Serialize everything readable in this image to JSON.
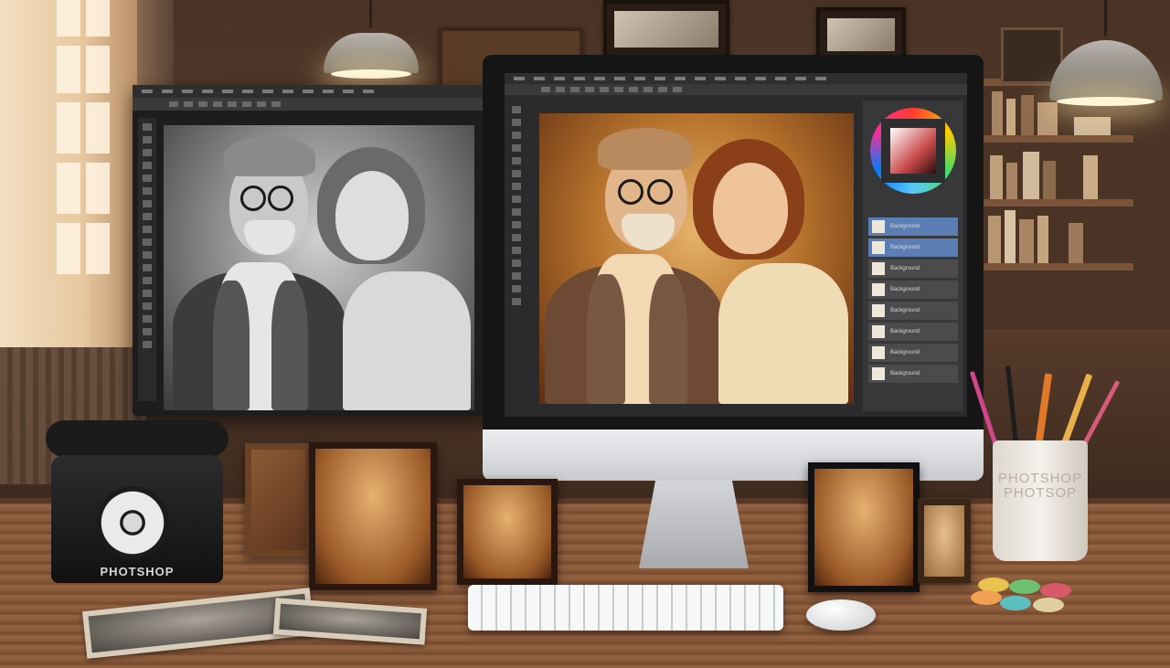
{
  "scene": {
    "description_visible_text": true
  },
  "left_monitor": {
    "app_menu_items": 12,
    "photo": "black-and-white portrait"
  },
  "imac_screen": {
    "panels": {
      "layers": [
        {
          "name": "Background",
          "selected": true
        },
        {
          "name": "Background",
          "selected": true
        },
        {
          "name": "Background",
          "selected": false
        },
        {
          "name": "Background",
          "selected": false
        },
        {
          "name": "Background",
          "selected": false
        },
        {
          "name": "Background",
          "selected": false
        },
        {
          "name": "Background",
          "selected": false
        },
        {
          "name": "Background",
          "selected": false
        }
      ]
    }
  },
  "desk": {
    "phone_label": "PHOTSHOP",
    "mug_text": "PHOTSHOP PHOTSOP"
  },
  "colors": {
    "accent_select": "#5b7fb5",
    "sepia": "#b9752e"
  }
}
